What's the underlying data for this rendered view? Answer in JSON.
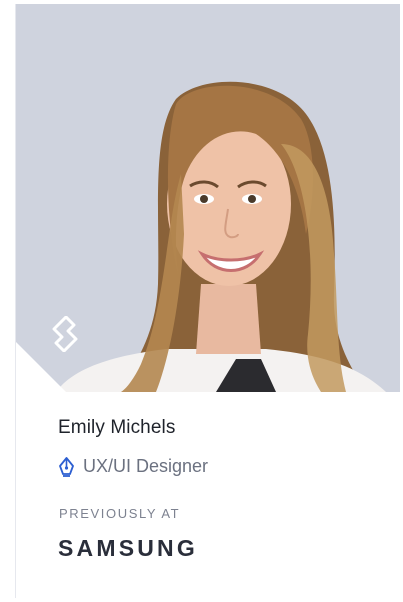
{
  "profile": {
    "name": "Emily Michels",
    "role_icon": "pen-nib-icon",
    "role": "UX/UI Designer",
    "previously_label": "PREVIOUSLY AT",
    "company": "SAMSUNG"
  },
  "brand": {
    "icon": "toptal-logo-icon"
  },
  "colors": {
    "photo_background": "#cfd3de",
    "accent": "#2d5fd1",
    "name_text": "#1f232b",
    "muted_text": "#6b7180"
  }
}
